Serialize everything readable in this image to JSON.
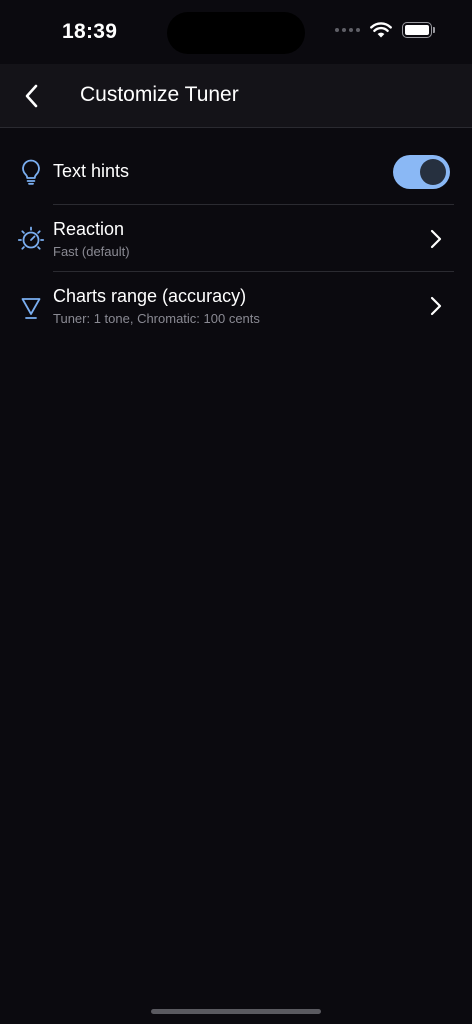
{
  "status_bar": {
    "time": "18:39",
    "icons": [
      "signal-dots-icon",
      "wifi-icon",
      "battery-icon"
    ]
  },
  "header": {
    "title": "Customize Tuner",
    "back_icon": "chevron-left-icon"
  },
  "settings": [
    {
      "title": "Text hints",
      "icon": "lightbulb-icon",
      "control": "toggle",
      "enabled": true
    },
    {
      "title": "Reaction",
      "subtitle": "Fast (default)",
      "icon": "gauge-icon"
    },
    {
      "title": "Charts range (accuracy)",
      "subtitle": "Tuner: 1 tone, Chromatic: 100 cents",
      "icon": "triangle-icon"
    }
  ],
  "colors": {
    "background": "#0b0a0f",
    "header": "#141318",
    "accent": "#8ab8f5",
    "icon": "#7aaef0",
    "subtitle": "#8a8a93"
  }
}
